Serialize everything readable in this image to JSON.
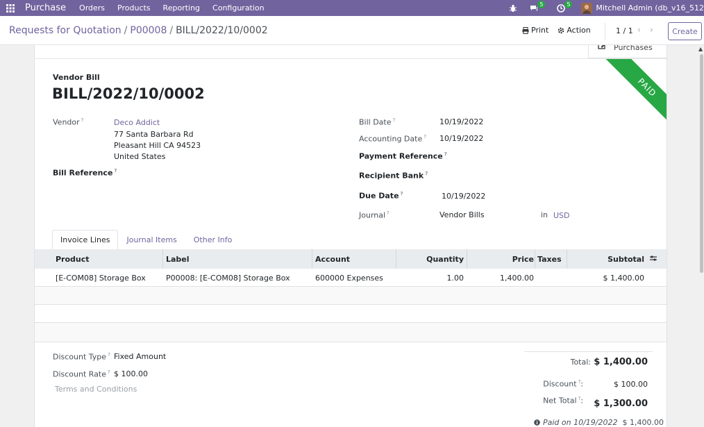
{
  "navbar": {
    "brand": "Purchase",
    "menu": [
      "Orders",
      "Products",
      "Reporting",
      "Configuration"
    ],
    "messages_count": "5",
    "activities_count": "5",
    "user": "Mitchell Admin (db_v16_512"
  },
  "control_panel": {
    "breadcrumb": [
      "Requests for Quotation",
      "P00008",
      "BILL/2022/10/0002"
    ],
    "print_label": "Print",
    "action_label": "Action",
    "pager": "1 / 1",
    "create_label": "Create"
  },
  "sheet": {
    "smart_button": "Purchases",
    "ribbon": "PAID",
    "doc_type": "Vendor Bill",
    "doc_name": "BILL/2022/10/0002",
    "vendor_label": "Vendor",
    "vendor_name": "Deco Addict",
    "vendor_address": [
      "77 Santa Barbara Rd",
      "Pleasant Hill CA 94523",
      "United States"
    ],
    "bill_reference_label": "Bill Reference",
    "bill_date_label": "Bill Date",
    "bill_date": "10/19/2022",
    "accounting_date_label": "Accounting Date",
    "accounting_date": "10/19/2022",
    "payment_reference_label": "Payment Reference",
    "recipient_bank_label": "Recipient Bank",
    "due_date_label": "Due Date",
    "due_date": "10/19/2022",
    "journal_label": "Journal",
    "journal": "Vendor Bills",
    "journal_in": "in",
    "currency": "USD"
  },
  "tabs": [
    "Invoice Lines",
    "Journal Items",
    "Other Info"
  ],
  "lines_table": {
    "columns": [
      "Product",
      "Label",
      "Account",
      "Quantity",
      "Price",
      "Taxes",
      "Subtotal"
    ],
    "rows": [
      {
        "product": "[E-COM08] Storage Box",
        "label": "P00008: [E-COM08] Storage Box",
        "account": "600000 Expenses",
        "quantity": "1.00",
        "price": "1,400.00",
        "taxes": "",
        "subtotal": "$ 1,400.00"
      }
    ]
  },
  "footer": {
    "discount_type_label": "Discount Type",
    "discount_type": "Fixed Amount",
    "discount_rate_label": "Discount Rate",
    "discount_rate": "$ 100.00",
    "terms_placeholder": "Terms and Conditions",
    "total_label": "Total:",
    "total": "$ 1,400.00",
    "discount_label": "Discount",
    "discount": "$ 100.00",
    "net_total_label": "Net Total",
    "net_total": "$ 1,300.00",
    "paid_on": "Paid on 10/19/2022",
    "paid_amount": "$ 1,400.00"
  },
  "colors": {
    "brand": "#71639e",
    "ribbon": "#28a745"
  }
}
